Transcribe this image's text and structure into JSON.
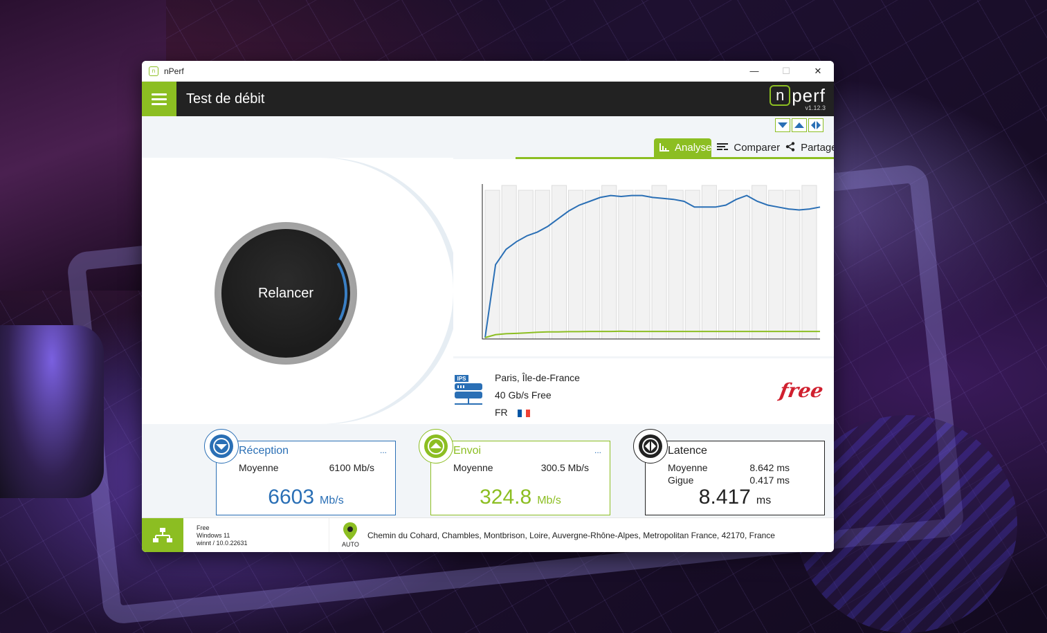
{
  "window": {
    "title": "nPerf",
    "minimize": "—",
    "maximize": "☐",
    "close": "✕"
  },
  "appbar": {
    "title": "Test de débit",
    "logo_n": "n",
    "logo_text": "perf",
    "version": "v1.12.3"
  },
  "tabs": [
    {
      "label": "Analyse",
      "icon": "bar-chart-icon",
      "active": true
    },
    {
      "label": "Comparer",
      "icon": "compare-icon",
      "active": false
    },
    {
      "label": "Partager",
      "icon": "share-icon",
      "active": false
    }
  ],
  "relaunch": {
    "label": "Relancer"
  },
  "chart_data": {
    "type": "line",
    "bars_count": 20,
    "series": [
      {
        "name": "",
        "color": "#2a6fb5",
        "values": [
          0,
          3800,
          4600,
          5000,
          5300,
          5500,
          5800,
          6200,
          6600,
          6900,
          7100,
          7300,
          7400,
          7350,
          7400,
          7400,
          7300,
          7250,
          7200,
          7100,
          6800,
          6800,
          6800,
          6900,
          7200,
          7400,
          7100,
          6900,
          6800,
          6700,
          6650,
          6700,
          6800
        ]
      },
      {
        "name": "",
        "color": "#8cbe22",
        "values": [
          0,
          150,
          200,
          220,
          250,
          280,
          300,
          300,
          310,
          310,
          320,
          320,
          320,
          330,
          320,
          320,
          320,
          320,
          320,
          320,
          320,
          320,
          320,
          320,
          320,
          320,
          320,
          320,
          320,
          320,
          320,
          320,
          320
        ]
      }
    ],
    "ylim": [
      0,
      8000
    ]
  },
  "server": {
    "icon_label": "IPS",
    "location": "Paris, Île-de-France",
    "capacity": "40 Gb/s Free",
    "country": "FR",
    "isp_logo": "free"
  },
  "reception": {
    "name": "Réception",
    "more": "...",
    "avg_label": "Moyenne",
    "avg_value": "6100 Mb/s",
    "value": "6603",
    "unit": "Mb/s",
    "color": "#2a6fb5"
  },
  "upload": {
    "name": "Envoi",
    "more": "...",
    "avg_label": "Moyenne",
    "avg_value": "300.5 Mb/s",
    "value": "324.8",
    "unit": "Mb/s",
    "color": "#8cbe22"
  },
  "latency": {
    "name": "Latence",
    "avg_label": "Moyenne",
    "avg_value": "8.642 ms",
    "jitter_label": "Gigue",
    "jitter_value": "0.417 ms",
    "value": "8.417",
    "unit": "ms"
  },
  "footer": {
    "isp": "Free",
    "os": "Windows 11",
    "build": "winnt / 10.0.22631",
    "auto_label": "AUTO",
    "address": "Chemin du Cohard, Chambles, Montbrison, Loire, Auvergne-Rhône-Alpes, Metropolitan France, 42170, France"
  }
}
